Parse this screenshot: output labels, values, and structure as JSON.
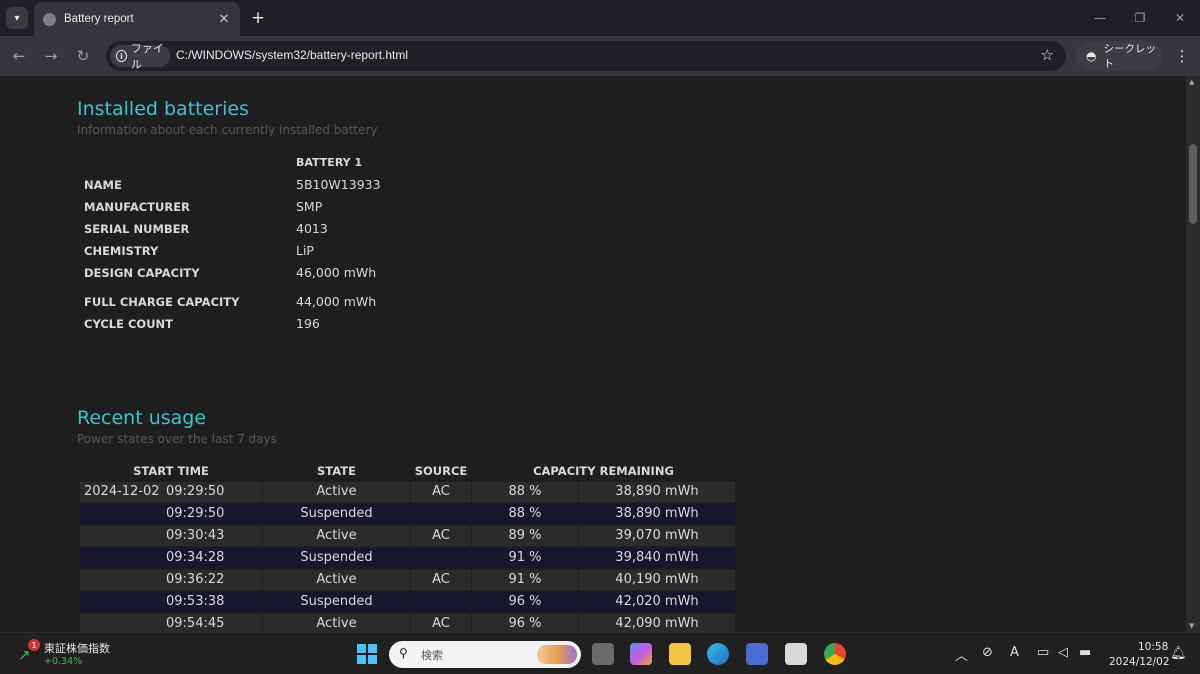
{
  "browser": {
    "tab_title": "Battery report",
    "site_label": "ファイル",
    "url": "C:/WINDOWS/system32/battery-report.html",
    "incognito_label": "シークレット"
  },
  "installed": {
    "title": "Installed batteries",
    "subtitle": "Information about each currently installed battery",
    "battery_header": "BATTERY 1",
    "rows": [
      {
        "key": "NAME",
        "value": "5B10W13933"
      },
      {
        "key": "MANUFACTURER",
        "value": "SMP"
      },
      {
        "key": "SERIAL NUMBER",
        "value": "4013"
      },
      {
        "key": "CHEMISTRY",
        "value": "LiP"
      },
      {
        "key": "DESIGN CAPACITY",
        "value": "46,000 mWh"
      },
      {
        "key": "FULL CHARGE CAPACITY",
        "value": "44,000 mWh"
      },
      {
        "key": "CYCLE COUNT",
        "value": "196"
      }
    ]
  },
  "usage": {
    "title": "Recent usage",
    "subtitle": "Power states over the last 7 days",
    "headers": {
      "start": "START TIME",
      "state": "STATE",
      "source": "SOURCE",
      "capacity": "CAPACITY REMAINING"
    },
    "rows": [
      {
        "date": "2024-12-02",
        "time": "09:29:50",
        "state": "Active",
        "source": "AC",
        "percent": "88 %",
        "mwh": "38,890 mWh"
      },
      {
        "date": "",
        "time": "09:29:50",
        "state": "Suspended",
        "source": "",
        "percent": "88 %",
        "mwh": "38,890 mWh"
      },
      {
        "date": "",
        "time": "09:30:43",
        "state": "Active",
        "source": "AC",
        "percent": "89 %",
        "mwh": "39,070 mWh"
      },
      {
        "date": "",
        "time": "09:34:28",
        "state": "Suspended",
        "source": "",
        "percent": "91 %",
        "mwh": "39,840 mWh"
      },
      {
        "date": "",
        "time": "09:36:22",
        "state": "Active",
        "source": "AC",
        "percent": "91 %",
        "mwh": "40,190 mWh"
      },
      {
        "date": "",
        "time": "09:53:38",
        "state": "Suspended",
        "source": "",
        "percent": "96 %",
        "mwh": "42,020 mWh"
      },
      {
        "date": "",
        "time": "09:54:45",
        "state": "Active",
        "source": "AC",
        "percent": "96 %",
        "mwh": "42,090 mWh"
      }
    ]
  },
  "taskbar": {
    "stock_badge": "1",
    "stock_name": "東証株価指数",
    "stock_change": "+0.34%",
    "search_placeholder": "検索",
    "time": "10:58",
    "date": "2024/12/02"
  },
  "colors": {
    "accent": "#39c5cf",
    "row_odd": "#2b2b2b",
    "row_even": "#17162f"
  }
}
